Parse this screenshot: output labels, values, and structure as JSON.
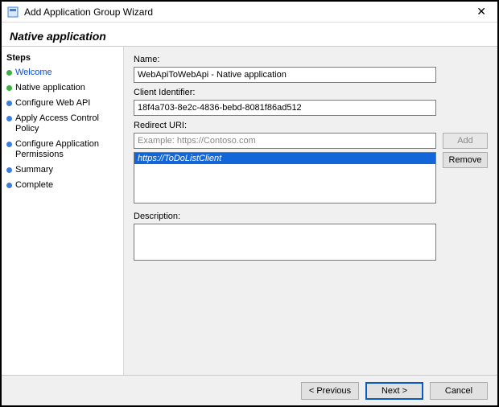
{
  "window": {
    "title": "Add Application Group Wizard",
    "close_glyph": "✕"
  },
  "header": {
    "title": "Native application"
  },
  "sidebar": {
    "heading": "Steps",
    "items": [
      {
        "label": "Welcome",
        "status": "completed"
      },
      {
        "label": "Native application",
        "status": "current"
      },
      {
        "label": "Configure Web API",
        "status": "pending"
      },
      {
        "label": "Apply Access Control Policy",
        "status": "pending"
      },
      {
        "label": "Configure Application Permissions",
        "status": "pending"
      },
      {
        "label": "Summary",
        "status": "pending"
      },
      {
        "label": "Complete",
        "status": "pending"
      }
    ]
  },
  "form": {
    "name_label": "Name:",
    "name_value": "WebApiToWebApi - Native application",
    "client_id_label": "Client Identifier:",
    "client_id_value": "18f4a703-8e2c-4836-bebd-8081f86ad512",
    "redirect_label": "Redirect URI:",
    "redirect_placeholder": "Example: https://Contoso.com",
    "redirect_value": "",
    "add_label": "Add",
    "remove_label": "Remove",
    "uri_list": [
      "https://ToDoListClient"
    ],
    "description_label": "Description:",
    "description_value": ""
  },
  "footer": {
    "previous_label": "< Previous",
    "next_label": "Next >",
    "cancel_label": "Cancel"
  }
}
